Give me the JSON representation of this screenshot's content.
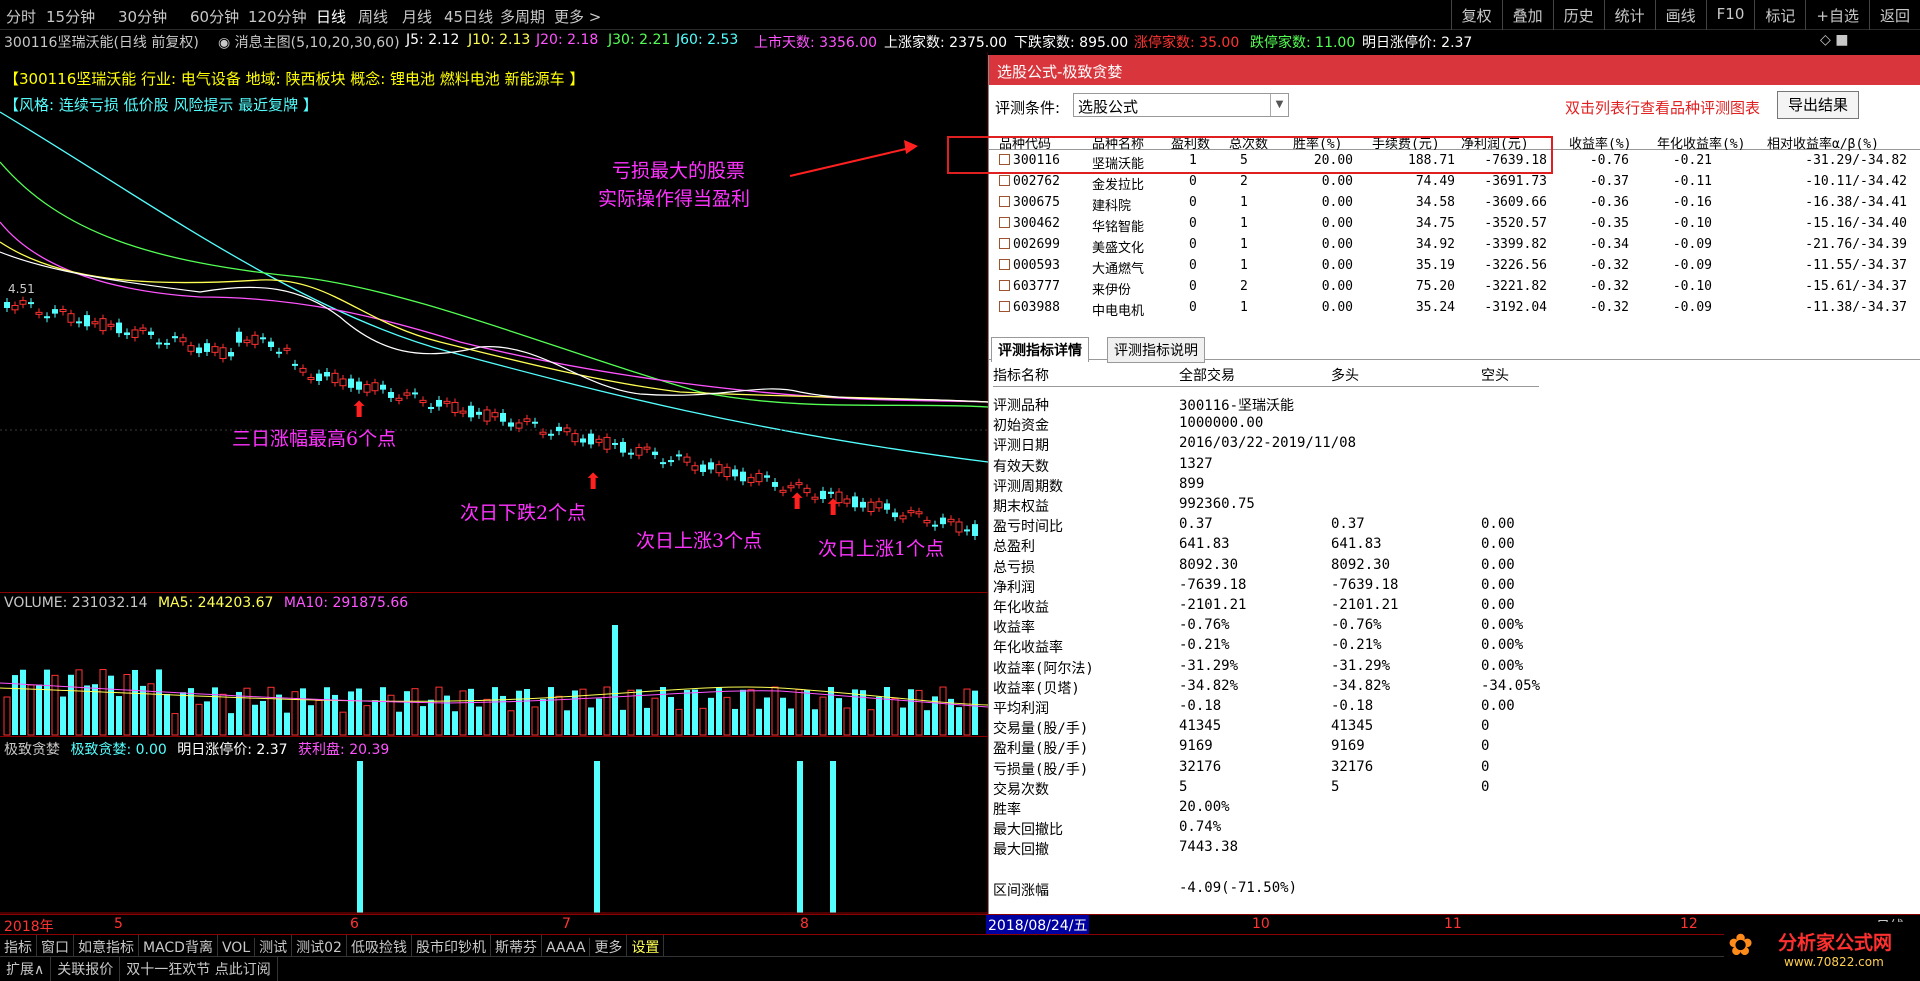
{
  "toolbar": {
    "periods": [
      "分时",
      "15分钟",
      "30分钟",
      "60分钟",
      "120分钟",
      "日线",
      "周线",
      "月线",
      "45日线",
      "多周期",
      "更多 >"
    ],
    "active": "日线",
    "right": [
      "复权",
      "叠加",
      "历史",
      "统计",
      "画线",
      "F10",
      "标记",
      "+自选",
      "返回"
    ]
  },
  "info": {
    "stock": "300116坚瑞沃能(日线 前复权)",
    "msg": "◉ 消息主图(5,10,20,30,60)",
    "j5": "J5: 2.12",
    "j10": "J10: 2.13",
    "j20": "J20: 2.18",
    "j30": "J30: 2.21",
    "j60": "J60: 2.53"
  },
  "stats": {
    "days": "上市天数: 3356.00",
    "up": "上涨家数: 2375.00",
    "down": "下跌家数: 895.00",
    "limit_up": "涨停家数: 35.00",
    "limit_down": "跌停家数: 11.00",
    "next_limit": "明日涨停价: 2.37",
    "icons": "◇ ■"
  },
  "chart": {
    "industry_line": "【300116坚瑞沃能 行业: 电气设备 地域: 陕西板块 概念: 锂电池 燃料电池 新能源车 】",
    "style_line": "【风格: 连续亏损 低价股 风险提示 最近复牌 】",
    "price_label": "4.51",
    "annotations": {
      "a1": "三日涨幅最高6个点",
      "a2": "次日下跌2个点",
      "a3": "次日上涨3个点",
      "a4": "次日上涨1个点",
      "a5": "亏损最大的股票",
      "a6": "实际操作得当盈利"
    }
  },
  "volume": {
    "label": "VOLUME: 231032.14",
    "ma5": "MA5: 244203.67",
    "ma10": "MA10: 291875.66"
  },
  "indicator": {
    "name": "极致贪婪",
    "value": "极致贪婪: 0.00",
    "next": "明日涨停价: 2.37",
    "profit": "获利盘: 20.39"
  },
  "dates": {
    "year": "2018年",
    "m5": "5",
    "m6": "6",
    "m7": "7",
    "m8": "8",
    "cursor": "2018/08/24/五",
    "m10": "10",
    "m11": "11",
    "m12": "12",
    "right": "日线"
  },
  "bottom_tabs": [
    "指标",
    "窗口",
    "如意指标",
    "MACD背离",
    "VOL",
    "测试",
    "测试02",
    "低吸捡钱",
    "股市印钞机",
    "斯蒂芬",
    "AAAA",
    "更多",
    "设置"
  ],
  "status": [
    "扩展∧",
    "关联报价",
    "双十一狂欢节 点此订阅"
  ],
  "dialog": {
    "title": "选股公式-极致贪婪",
    "cond_label": "评测条件:",
    "cond_value": "选股公式",
    "hint": "双击列表行查看品种评测图表",
    "export": "导出结果",
    "headers": [
      "品种代码",
      "品种名称",
      "盈利数",
      "总次数",
      "胜率(%)",
      "手续费(元)",
      "净利润(元)",
      "收益率(%)",
      "年化收益率(%)",
      "相对收益率α/β(%)"
    ],
    "rows": [
      [
        "300116",
        "坚瑞沃能",
        "1",
        "5",
        "20.00",
        "188.71",
        "-7639.18",
        "-0.76",
        "-0.21",
        "-31.29/-34.82"
      ],
      [
        "002762",
        "金发拉比",
        "0",
        "2",
        "0.00",
        "74.49",
        "-3691.73",
        "-0.37",
        "-0.11",
        "-10.11/-34.42"
      ],
      [
        "300675",
        "建科院",
        "0",
        "1",
        "0.00",
        "34.58",
        "-3609.66",
        "-0.36",
        "-0.16",
        "-16.38/-34.41"
      ],
      [
        "300462",
        "华铭智能",
        "0",
        "1",
        "0.00",
        "34.75",
        "-3520.57",
        "-0.35",
        "-0.10",
        "-15.16/-34.40"
      ],
      [
        "002699",
        "美盛文化",
        "0",
        "1",
        "0.00",
        "34.92",
        "-3399.82",
        "-0.34",
        "-0.09",
        "-21.76/-34.39"
      ],
      [
        "000593",
        "大通燃气",
        "0",
        "1",
        "0.00",
        "35.19",
        "-3226.56",
        "-0.32",
        "-0.09",
        "-11.55/-34.37"
      ],
      [
        "603777",
        "来伊份",
        "0",
        "2",
        "0.00",
        "75.20",
        "-3221.82",
        "-0.32",
        "-0.10",
        "-15.61/-34.37"
      ],
      [
        "603988",
        "中电电机",
        "0",
        "1",
        "0.00",
        "35.24",
        "-3192.04",
        "-0.32",
        "-0.09",
        "-11.38/-34.37"
      ]
    ],
    "tabs": [
      "评测指标详情",
      "评测指标说明"
    ],
    "metric_headers": [
      "指标名称",
      "全部交易",
      "多头",
      "空头"
    ],
    "metrics": [
      [
        "评测品种",
        "300116-坚瑞沃能",
        "",
        ""
      ],
      [
        "初始资金",
        "1000000.00",
        "",
        ""
      ],
      [
        "评测日期",
        "2016/03/22-2019/11/08",
        "",
        ""
      ],
      [
        "有效天数",
        "1327",
        "",
        ""
      ],
      [
        "评测周期数",
        "899",
        "",
        ""
      ],
      [
        "期末权益",
        "992360.75",
        "",
        ""
      ],
      [
        "盈亏时间比",
        "0.37",
        "0.37",
        "0.00"
      ],
      [
        "总盈利",
        "641.83",
        "641.83",
        "0.00"
      ],
      [
        "总亏损",
        "8092.30",
        "8092.30",
        "0.00"
      ],
      [
        "净利润",
        "-7639.18",
        "-7639.18",
        "0.00"
      ],
      [
        "年化收益",
        "-2101.21",
        "-2101.21",
        "0.00"
      ],
      [
        "收益率",
        "-0.76%",
        "-0.76%",
        "0.00%"
      ],
      [
        "年化收益率",
        "-0.21%",
        "-0.21%",
        "0.00%"
      ],
      [
        "收益率(阿尔法)",
        "-31.29%",
        "-31.29%",
        "0.00%"
      ],
      [
        "收益率(贝塔)",
        "-34.82%",
        "-34.82%",
        "-34.05%"
      ],
      [
        "平均利润",
        "-0.18",
        "-0.18",
        "0.00"
      ],
      [
        "交易量(股/手)",
        "41345",
        "41345",
        "0"
      ],
      [
        "盈利量(股/手)",
        "9169",
        "9169",
        "0"
      ],
      [
        "亏损量(股/手)",
        "32176",
        "32176",
        "0"
      ],
      [
        "交易次数",
        "5",
        "5",
        "0"
      ],
      [
        "胜率",
        "20.00%",
        "",
        ""
      ],
      [
        "最大回撤比",
        "0.74%",
        "",
        ""
      ],
      [
        "最大回撤",
        "7443.38",
        "",
        ""
      ],
      [
        "",
        "",
        " ",
        ""
      ],
      [
        "区间涨幅",
        "-4.09(-71.50%)",
        "",
        ""
      ]
    ]
  },
  "watermark": {
    "name": "分析家公式网",
    "url": "www.70822.com"
  }
}
